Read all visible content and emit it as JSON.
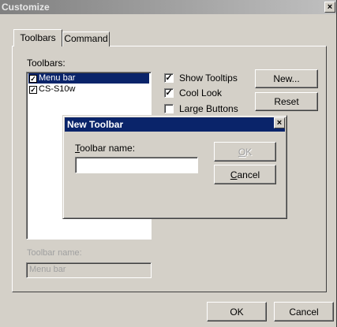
{
  "customize": {
    "title": "Customize",
    "close_glyph": "×",
    "tabs": [
      {
        "label": "Toolbars"
      },
      {
        "label": "Command"
      }
    ],
    "toolbars_label": "Toolbars:",
    "toolbars": [
      {
        "label": "Menu bar",
        "checked": true,
        "selected": true
      },
      {
        "label": "CS-S10w",
        "checked": true,
        "selected": false
      }
    ],
    "checkboxes": [
      {
        "label": "Show Tooltips",
        "checked": true
      },
      {
        "label": "Cool Look",
        "checked": true
      },
      {
        "label": "Large Buttons",
        "checked": false
      }
    ],
    "new_button": "New...",
    "reset_button": "Reset",
    "toolbar_name_label": "Toolbar name:",
    "toolbar_name_value": "Menu bar",
    "ok_button": "OK",
    "cancel_button": "Cancel"
  },
  "new_toolbar": {
    "title": "New Toolbar",
    "close_glyph": "×",
    "name_label_mnemonic": "T",
    "name_label_rest": "oolbar name:",
    "name_value": "",
    "ok_mnemonic": "O",
    "ok_rest": "K",
    "cancel_mnemonic": "C",
    "cancel_rest": "ancel"
  },
  "colors": {
    "face": "#d4d0c8",
    "active_title": "#0a246a",
    "inactive_title": "#808080",
    "selection": "#0a246a",
    "disabled_text": "#a0a0a0"
  },
  "icons": {
    "close": "close-icon",
    "check": "check-icon"
  }
}
